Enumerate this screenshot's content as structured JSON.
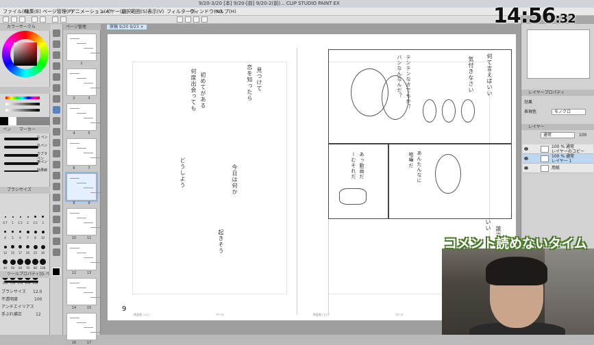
{
  "titlebar": {
    "title": "9/20-3/20 [本] 9/20-[前] 9/20-2(前)... CLIP STUDIO PAINT EX"
  },
  "menubar": {
    "items": [
      "ファイル(F)",
      "編集(E)",
      "ページ管理(P)",
      "アニメーション(A)",
      "レイヤー(L)",
      "選択範囲(S)",
      "表示(V)",
      "フィルター(I)",
      "ウィンドウ(W)",
      "ヘルプ(H)"
    ]
  },
  "clock": {
    "hm": "14:56",
    "sec": ":32"
  },
  "left_panel": {
    "color_tab": "カラーサークル",
    "brush_tab": "ペン",
    "brush_tab2": "マーカー",
    "brush_names": [
      "G ペン",
      "丸ペン",
      "カブラペン",
      "筆ペン",
      "効果線"
    ],
    "size_tab": "ブラシサイズ",
    "size_values": [
      "0.7",
      "1",
      "1.5",
      "2",
      "2.5",
      "3",
      "4",
      "5",
      "6",
      "7",
      "8",
      "10",
      "12",
      "15",
      "17",
      "20",
      "25",
      "30",
      "40",
      "50",
      "60",
      "70",
      "80",
      "100",
      "120",
      "150",
      "170",
      "200",
      "250"
    ],
    "tool_prop_tab": "ツールプロパティ[G ペン]",
    "props": [
      {
        "label": "ブラシサイズ",
        "value": "12.0"
      },
      {
        "label": "不透明度",
        "value": "100"
      },
      {
        "label": "アンチエイリアス",
        "value": ""
      },
      {
        "label": "手ぶれ補正",
        "value": "12"
      }
    ]
  },
  "page_list": {
    "header": "ページ管理",
    "pages": [
      {
        "label": "1"
      },
      {
        "label": "2",
        "label2": "3"
      },
      {
        "label": "4",
        "label2": "5"
      },
      {
        "label": "6",
        "label2": "7"
      },
      {
        "label": "8",
        "label2": "9",
        "selected": true
      },
      {
        "label": "10",
        "label2": "11"
      },
      {
        "label": "12",
        "label2": "13"
      },
      {
        "label": "14",
        "label2": "15"
      },
      {
        "label": "16",
        "label2": "17"
      }
    ]
  },
  "canvas": {
    "doc_tab": "原稿 9/20 9/23 ×",
    "page_number": "9",
    "footer_left": "作品名 ○○○",
    "footer_mid": "ページ",
    "footer_right_a": "作品名 ○○○",
    "footer_right_b": "ページ",
    "left_page_columns": [
      "何度出会っても",
      "初めてがある",
      "恋を知ったら",
      "見つけて",
      "どうしよう",
      "今日は何か",
      "起きそう"
    ],
    "right_page_columns": [
      "テンテンなきでもか？",
      "バンなんなんだ？",
      "何て言えばいい",
      "気付きなさい",
      "あっ動画だ",
      "ーむそれだ",
      "あんたんなに",
      "喧嘩だ",
      "誰でも",
      "いい"
    ]
  },
  "right_panel": {
    "layer_prop_tab": "レイヤープロパティ",
    "effect_label": "効果",
    "color_label": "表現色",
    "color_value": "モノクロ",
    "layer_tab": "レイヤー",
    "blend_label": "通常",
    "opacity": "100",
    "layers": [
      {
        "name": "100 % 通常",
        "sub": "レイヤーのコピー",
        "selected": false
      },
      {
        "name": "100 % 通常",
        "sub": "レイヤー 1",
        "selected": true
      },
      {
        "name": "用紙",
        "sub": "",
        "selected": false
      }
    ]
  },
  "overlay": {
    "caption": "コメント読めないタイム"
  }
}
